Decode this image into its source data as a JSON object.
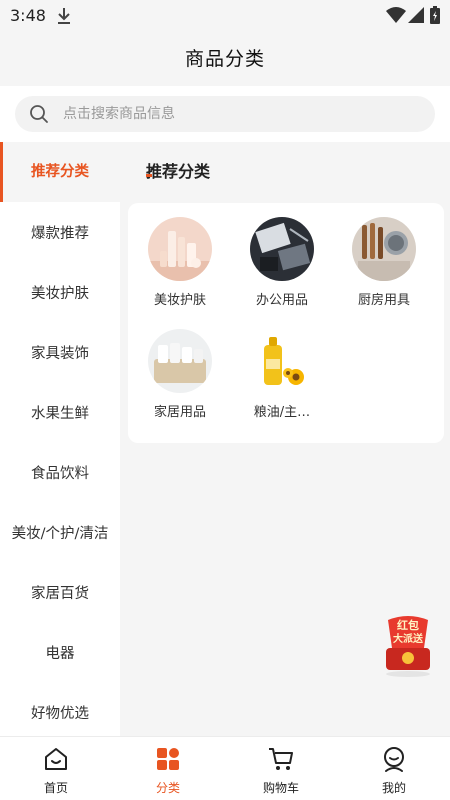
{
  "status_bar": {
    "time": "3:48"
  },
  "header": {
    "title": "商品分类"
  },
  "search": {
    "placeholder": "点击搜索商品信息"
  },
  "sidebar": {
    "items": [
      {
        "label": "推荐分类",
        "active": true
      },
      {
        "label": "爆款推荐"
      },
      {
        "label": "美妆护肤"
      },
      {
        "label": "家具装饰"
      },
      {
        "label": "水果生鲜"
      },
      {
        "label": "食品饮料"
      },
      {
        "label": "美妆/个护/清洁"
      },
      {
        "label": "家居百货"
      },
      {
        "label": "电器"
      },
      {
        "label": "好物优选"
      }
    ]
  },
  "main": {
    "section_title": "推荐分类",
    "categories": [
      {
        "label": "美妆护肤",
        "icon": "cosmetics-icon"
      },
      {
        "label": "办公用品",
        "icon": "office-supplies-icon"
      },
      {
        "label": "厨房用具",
        "icon": "kitchenware-icon"
      },
      {
        "label": "家居用品",
        "icon": "home-goods-icon"
      },
      {
        "label": "粮油/主…",
        "icon": "grain-oil-icon"
      }
    ]
  },
  "promo": {
    "text_line1": "红包",
    "text_line2": "大派送"
  },
  "tabbar": {
    "tabs": [
      {
        "label": "首页",
        "icon": "home-icon"
      },
      {
        "label": "分类",
        "icon": "category-icon",
        "active": true
      },
      {
        "label": "购物车",
        "icon": "cart-icon"
      },
      {
        "label": "我的",
        "icon": "profile-icon"
      }
    ]
  },
  "colors": {
    "accent": "#e85521",
    "background": "#f5f5f5"
  }
}
